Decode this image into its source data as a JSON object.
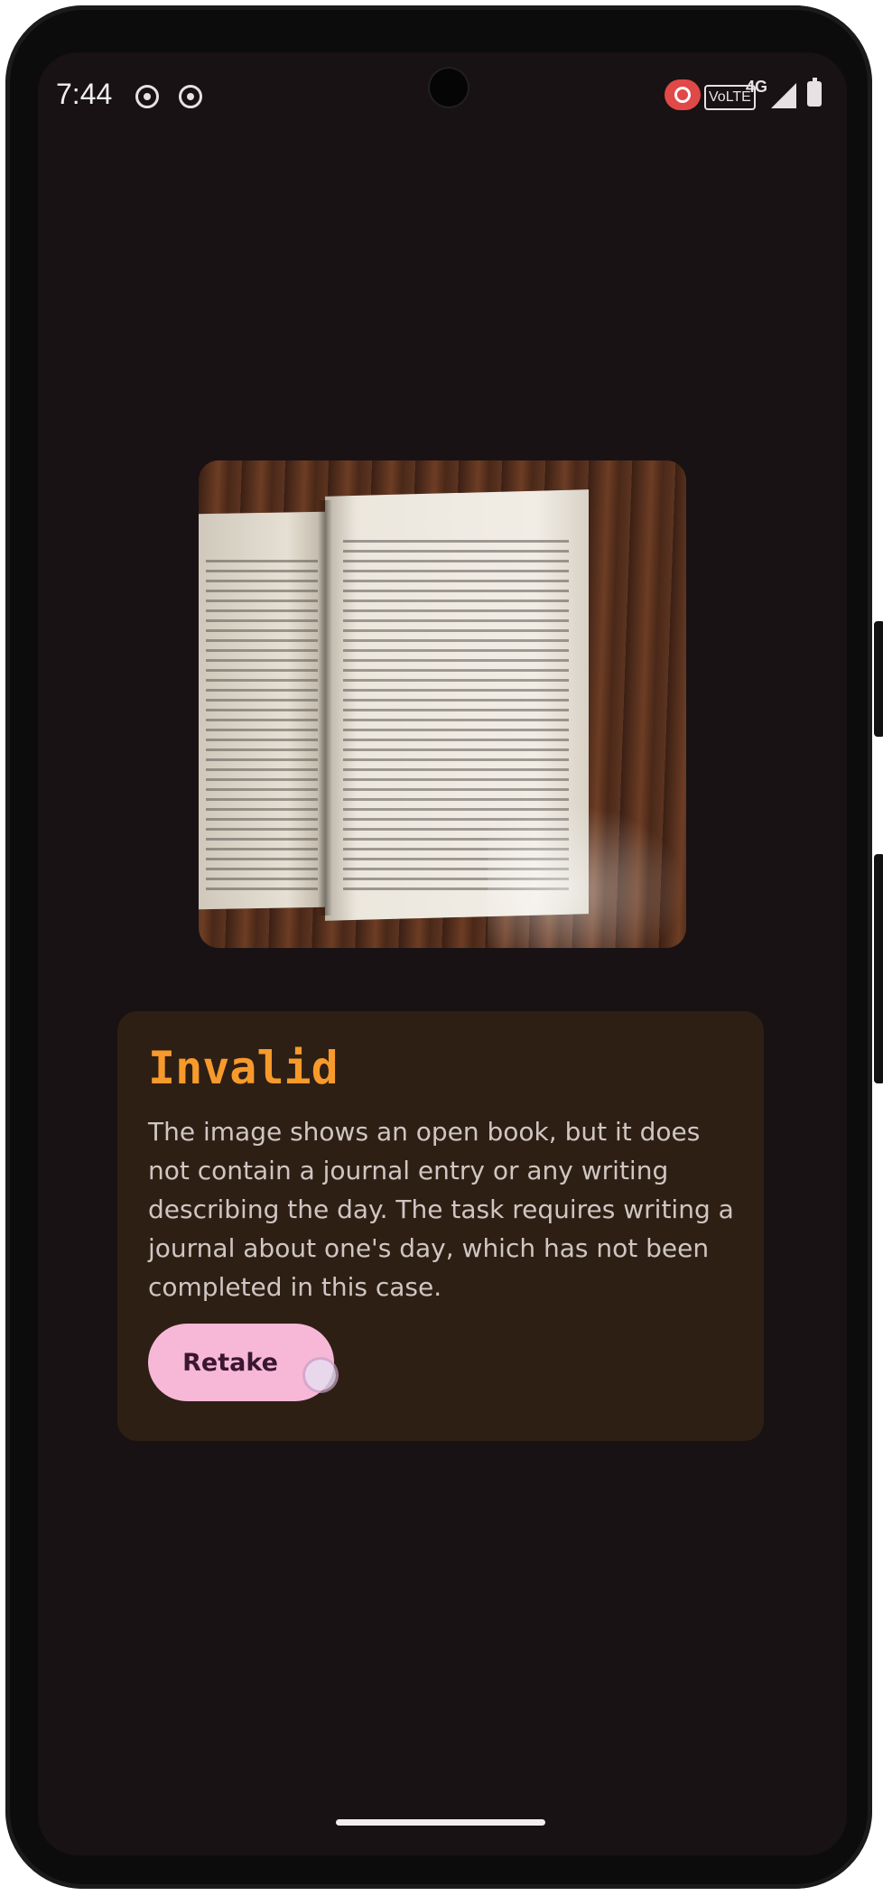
{
  "status_bar": {
    "time": "7:44",
    "icons": [
      "screen-record-icon",
      "screen-record-icon",
      "record-badge-icon",
      "volte-icon",
      "signal-icon",
      "battery-charging-icon"
    ],
    "volte": "VoLTE",
    "network": "4G"
  },
  "photo": {
    "description_icon": "book-photo"
  },
  "result": {
    "title": "Invalid",
    "message": "The image shows an open book, but it does not contain a journal entry or any writing describing the day. The task requires writing a journal about one's day, which has not been completed in this case.",
    "retake_label": "Retake"
  },
  "colors": {
    "background": "#181214",
    "card": "#2e1f14",
    "title": "#f79a2c",
    "button": "#f7b8d8"
  }
}
